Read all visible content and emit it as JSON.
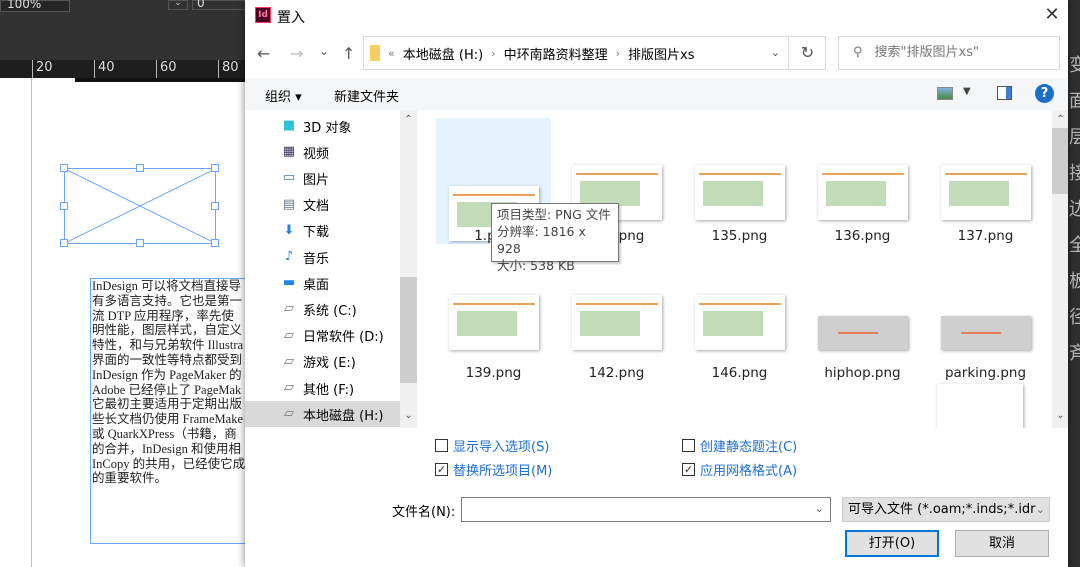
{
  "indesign": {
    "zoom": "100%",
    "stroke_value": "0",
    "ruler": [
      "20",
      "40",
      "60",
      "80"
    ],
    "text": [
      "InDesign 可以将文档直接导",
      "有多语言支持。它也是第一",
      "流 DTP 应用程序，率先使",
      "明性能，图层样式，自定义",
      "特性，和与兄弟软件 Illustra",
      "界面的一致性等特点都受到",
      "InDesign 作为 PageMaker 的",
      "Adobe 已经停止了 PageMak",
      "它最初主要适用于定期出版",
      "些长文档仍使用 FrameMake",
      "或 QuarkXPress（书籍，商",
      "的合并，InDesign 和使用相",
      "InCopy 的共用，已经使它成",
      "的重要软件。"
    ],
    "right_panel_chars": [
      "变",
      "面",
      "层",
      "接",
      "边",
      "全",
      "板",
      "径",
      "斉"
    ]
  },
  "dialog": {
    "app_icon": "Id",
    "title": "置入",
    "close": "✕",
    "nav": {
      "back": "←",
      "forward": "→",
      "recent": "⌄",
      "up": "↑"
    },
    "address": {
      "overflow": "«",
      "segments": [
        "本地磁盘 (H:)",
        "中环南路资料整理",
        "排版图片xs"
      ]
    },
    "search_placeholder": "搜索\"排版图片xs\"",
    "toolbar": {
      "organize": "组织 ▾",
      "new_folder": "新建文件夹",
      "help": "?"
    },
    "nav_pane": [
      {
        "label": "3D 对象",
        "icon": "cube-icon"
      },
      {
        "label": "视频",
        "icon": "video-icon"
      },
      {
        "label": "图片",
        "icon": "pictures-icon"
      },
      {
        "label": "文档",
        "icon": "documents-icon"
      },
      {
        "label": "下载",
        "icon": "download-icon"
      },
      {
        "label": "音乐",
        "icon": "music-icon"
      },
      {
        "label": "桌面",
        "icon": "desktop-icon"
      },
      {
        "label": "系统 (C:)",
        "icon": "drive-icon"
      },
      {
        "label": "日常软件 (D:)",
        "icon": "drive-icon"
      },
      {
        "label": "游戏 (E:)",
        "icon": "drive-icon"
      },
      {
        "label": "其他 (F:)",
        "icon": "drive-icon"
      },
      {
        "label": "本地磁盘 (H:)",
        "icon": "drive-icon",
        "selected": true
      }
    ],
    "files": [
      {
        "name": "1.png",
        "selected": true
      },
      {
        "name": "134.png"
      },
      {
        "name": "135.png"
      },
      {
        "name": "136.png"
      },
      {
        "name": "137.png"
      },
      {
        "name": "139.png"
      },
      {
        "name": "142.png"
      },
      {
        "name": "146.png"
      },
      {
        "name": "hiphop.png"
      },
      {
        "name": "parking.png"
      }
    ],
    "tooltip": {
      "type": "项目类型: PNG 文件",
      "resolution": "分辨率: 1816 x 928",
      "size": "大小: 538 KB"
    },
    "options": [
      {
        "label": "显示导入选项(S)",
        "checked": false
      },
      {
        "label": "替换所选项目(M)",
        "checked": true
      },
      {
        "label": "创建静态题注(C)",
        "checked": false
      },
      {
        "label": "应用网格格式(A)",
        "checked": true
      }
    ],
    "filename_label": "文件名(N):",
    "filename_value": "",
    "filetype": "可导入文件 (*.oam;*.inds;*.idr",
    "open": "打开(O)",
    "cancel": "取消"
  }
}
